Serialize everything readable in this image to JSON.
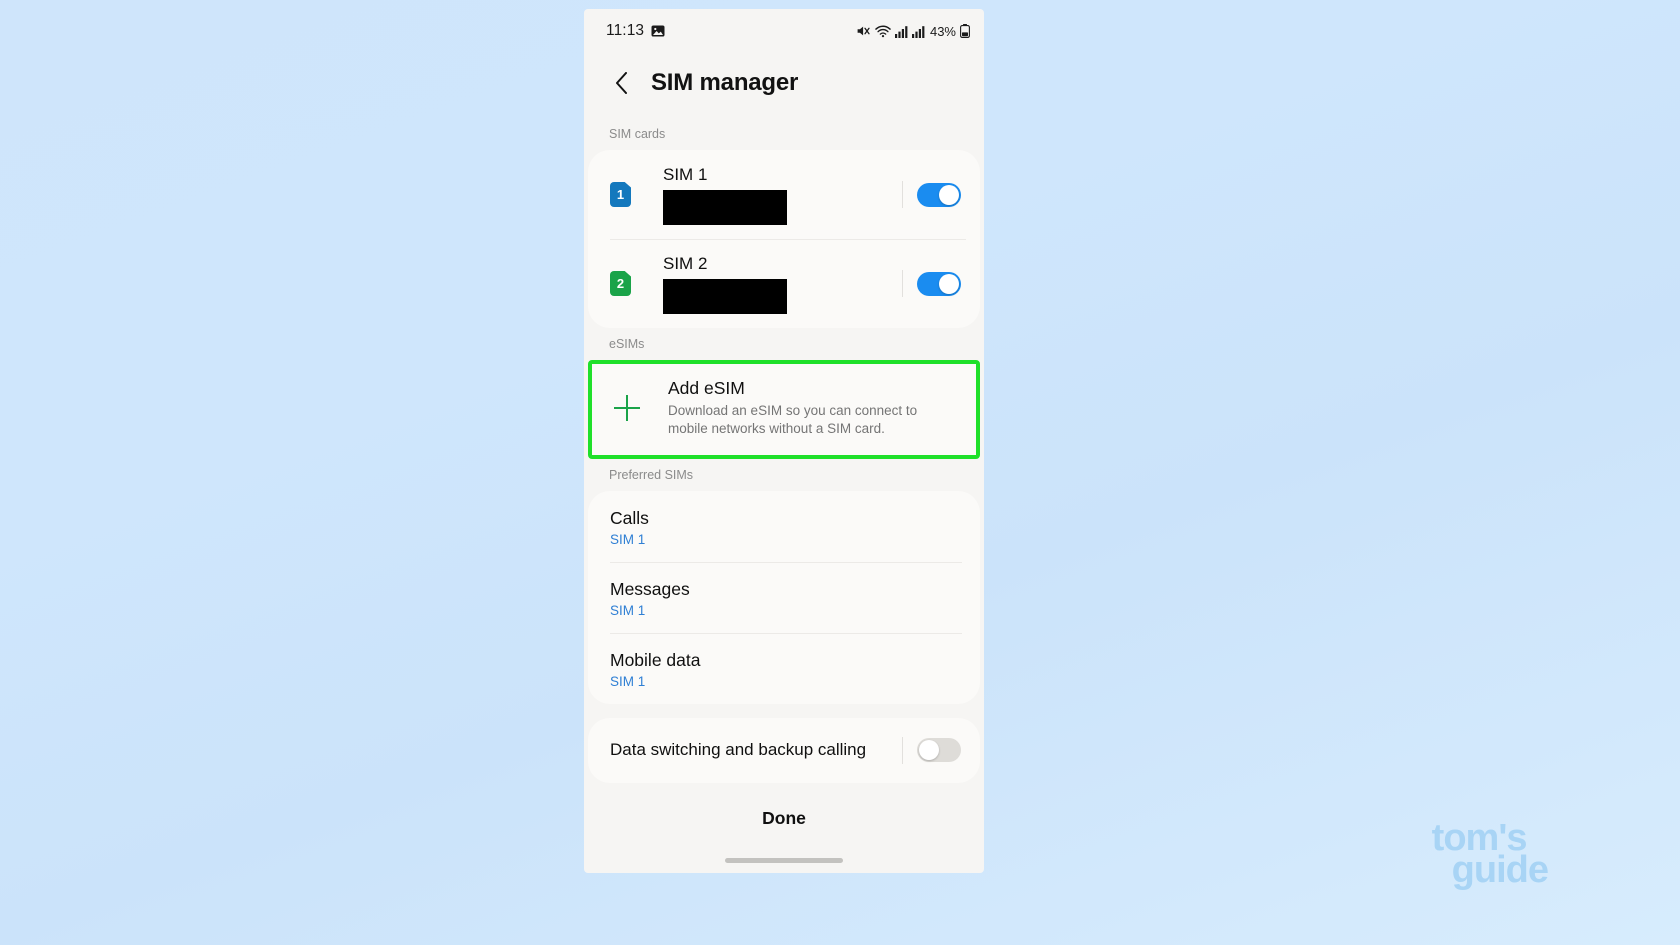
{
  "statusbar": {
    "time": "11:13",
    "image_icon": "image-icon",
    "mute_icon": "mute-icon",
    "wifi_icon": "wifi-icon",
    "signal1_icon": "signal-bars-icon",
    "signal2_icon": "signal-bars-icon",
    "battery_percent": "43%",
    "battery_icon": "battery-icon"
  },
  "header": {
    "back_icon": "back-chevron-icon",
    "title": "SIM manager"
  },
  "sim_cards": {
    "section_label": "SIM cards",
    "items": [
      {
        "badge": "1",
        "badge_color": "#1478bd",
        "name": "SIM 1",
        "carrier": "",
        "carrier_redacted": true,
        "toggle_on": true
      },
      {
        "badge": "2",
        "badge_color": "#1aa349",
        "name": "SIM 2",
        "carrier": "",
        "carrier_redacted": true,
        "toggle_on": true
      }
    ]
  },
  "esims": {
    "section_label": "eSIMs",
    "highlight_color": "#1fe02a",
    "add": {
      "icon": "plus-icon",
      "title": "Add eSIM",
      "description": "Download an eSIM so you can connect to mobile networks without a SIM card."
    }
  },
  "preferred_sims": {
    "section_label": "Preferred SIMs",
    "rows": [
      {
        "title": "Calls",
        "value": "SIM 1"
      },
      {
        "title": "Messages",
        "value": "SIM 1"
      },
      {
        "title": "Mobile data",
        "value": "SIM 1"
      }
    ]
  },
  "data_switching": {
    "label": "Data switching and backup calling",
    "toggle_on": false
  },
  "footer": {
    "done_label": "Done"
  },
  "watermark": {
    "line1": "tom's",
    "line2": "guide",
    "color": "#a8d4f5"
  }
}
